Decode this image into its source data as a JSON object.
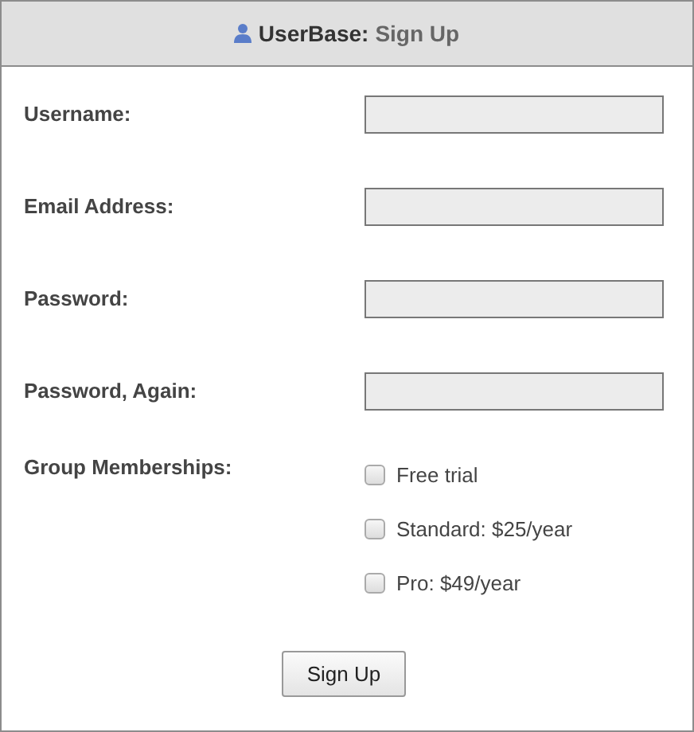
{
  "header": {
    "app_name": "UserBase:",
    "page_title": "Sign Up"
  },
  "fields": [
    {
      "label": "Username:"
    },
    {
      "label": "Email Address:"
    },
    {
      "label": "Password:"
    },
    {
      "label": "Password, Again:"
    }
  ],
  "groups": {
    "label": "Group Memberships:",
    "options": [
      {
        "label": "Free trial",
        "checked": false
      },
      {
        "label": "Standard: $25/year",
        "checked": false
      },
      {
        "label": "Pro: $49/year",
        "checked": false
      }
    ]
  },
  "submit": "Sign Up"
}
